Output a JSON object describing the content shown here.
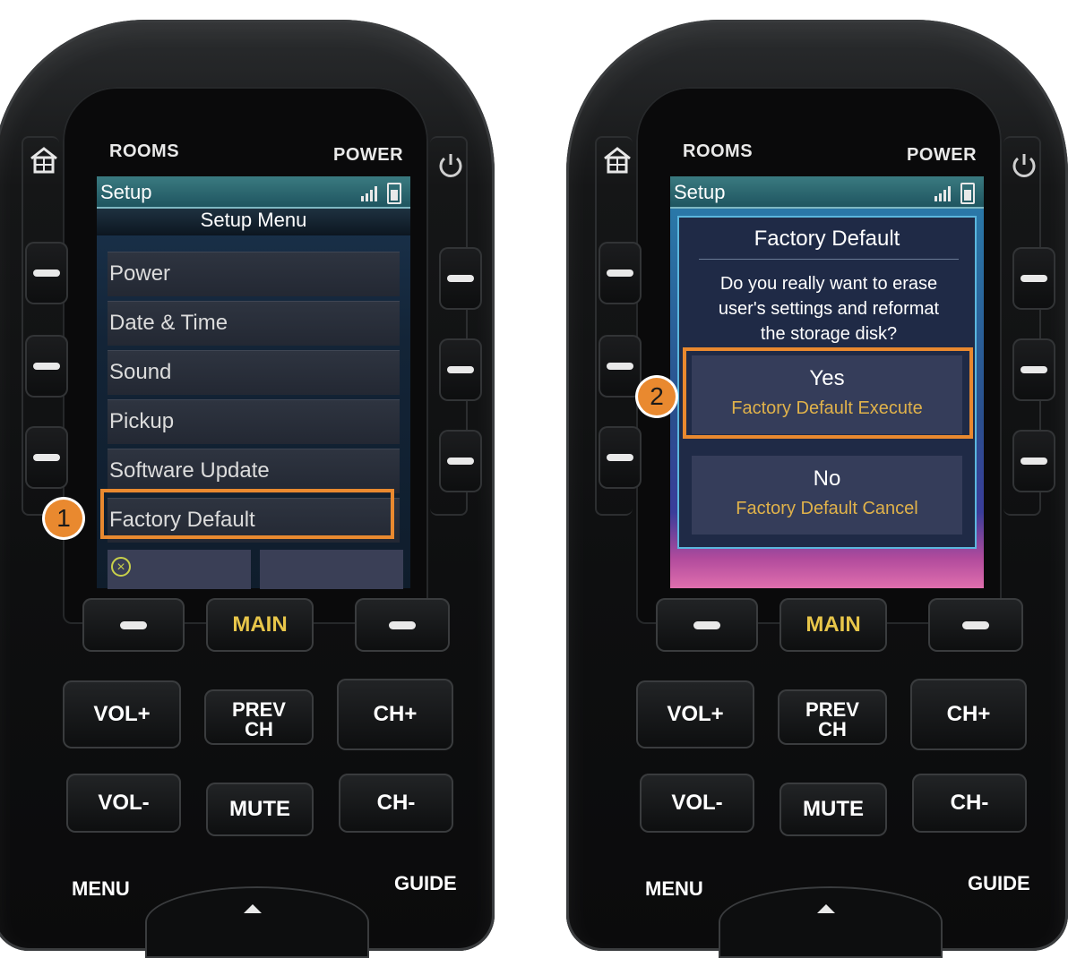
{
  "left_remote": {
    "top_labels": {
      "rooms": "ROOMS",
      "power": "POWER"
    },
    "screen": {
      "status_title": "Setup",
      "menu_title": "Setup Menu",
      "items": [
        "Power",
        "Date & Time",
        "Sound",
        "Pickup",
        "Software Update",
        "Factory Default"
      ]
    },
    "step_badge": "1",
    "buttons": {
      "main": "MAIN",
      "vol_up": "VOL+",
      "prev_ch_line1": "PREV",
      "prev_ch_line2": "CH",
      "ch_up": "CH+",
      "vol_down": "VOL-",
      "mute": "MUTE",
      "ch_down": "CH-",
      "menu": "MENU",
      "guide": "GUIDE"
    }
  },
  "right_remote": {
    "top_labels": {
      "rooms": "ROOMS",
      "power": "POWER"
    },
    "screen": {
      "status_title": "Setup",
      "dialog_title": "Factory Default",
      "dialog_message_1": "Do you really want to erase",
      "dialog_message_2": "user's settings and reformat",
      "dialog_message_3": "the storage disk?",
      "yes_label": "Yes",
      "yes_sub": "Factory Default Execute",
      "no_label": "No",
      "no_sub": "Factory Default Cancel"
    },
    "step_badge": "2",
    "buttons": {
      "main": "MAIN",
      "vol_up": "VOL+",
      "prev_ch_line1": "PREV",
      "prev_ch_line2": "CH",
      "ch_up": "CH+",
      "vol_down": "VOL-",
      "mute": "MUTE",
      "ch_down": "CH-",
      "menu": "MENU",
      "guide": "GUIDE"
    }
  },
  "colors": {
    "highlight": "#e9892f",
    "main_text": "#e8c64a",
    "sub_text": "#e0b24a"
  },
  "icons": [
    "house-icon",
    "power-icon",
    "signal-icon",
    "battery-icon",
    "cancel-icon",
    "up-arrow-icon"
  ]
}
